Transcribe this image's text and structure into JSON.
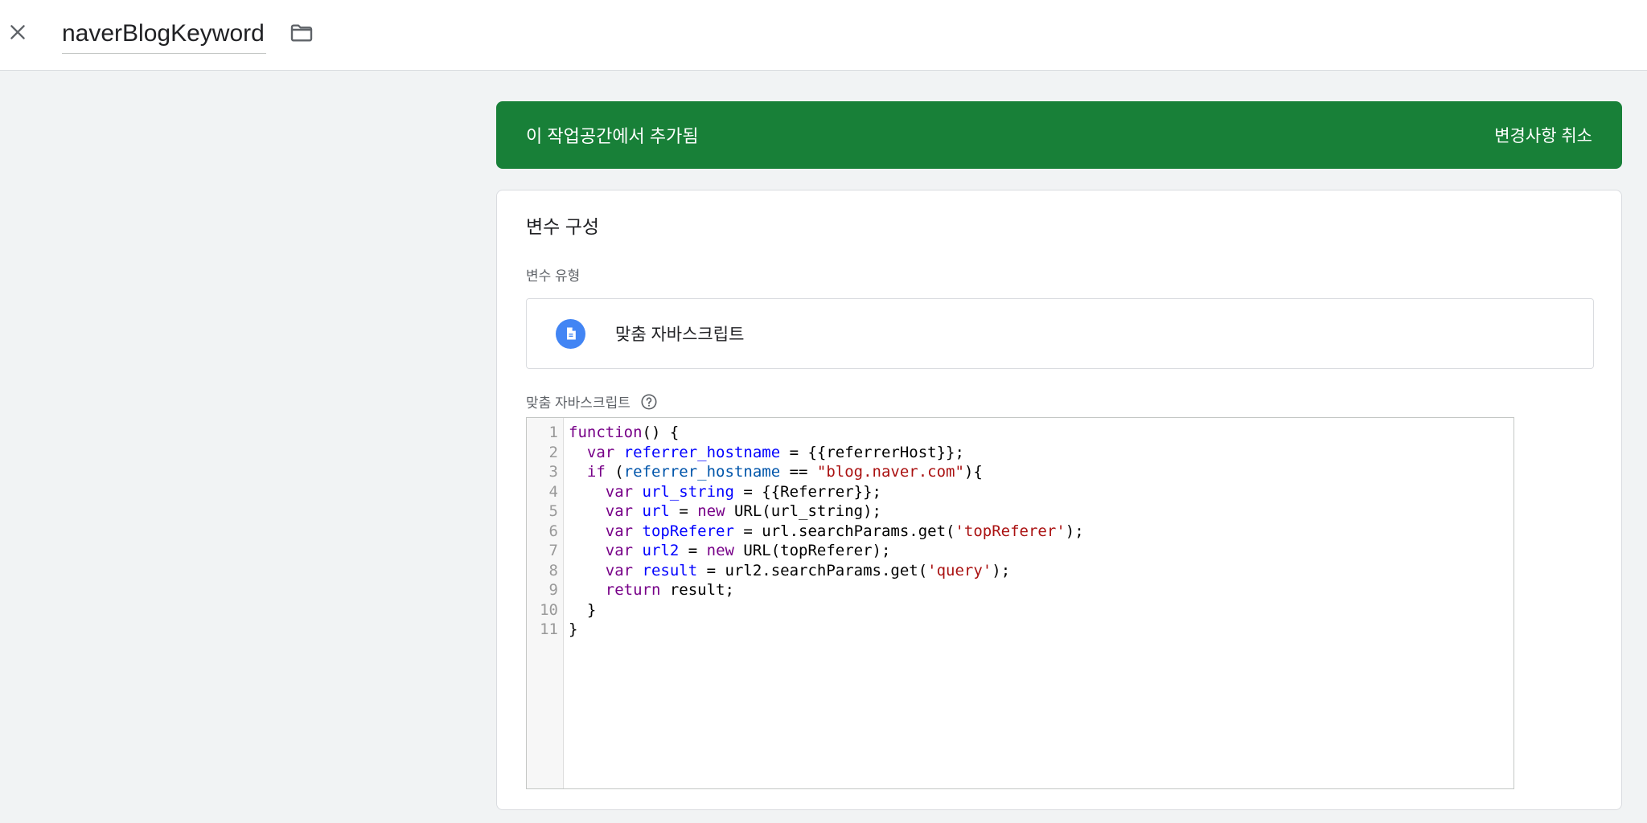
{
  "header": {
    "title": "naverBlogKeyword",
    "close_icon": "close-icon",
    "folder_icon": "folder-icon"
  },
  "banner": {
    "message": "이 작업공간에서 추가됨",
    "action_label": "변경사항 취소",
    "color": "#188038"
  },
  "config": {
    "section_title": "변수 구성",
    "type_label": "변수 유형",
    "type_name": "맞춤 자바스크립트",
    "type_icon": "document-icon",
    "code_label": "맞춤 자바스크립트",
    "help_icon": "help-icon"
  },
  "code": {
    "line_numbers": [
      "1",
      "2",
      "3",
      "4",
      "5",
      "6",
      "7",
      "8",
      "9",
      "10",
      "11"
    ],
    "lines": [
      {
        "indent": "",
        "tokens": [
          {
            "t": "function",
            "c": "kw"
          },
          {
            "t": "() {",
            "c": ""
          }
        ]
      },
      {
        "indent": "  ",
        "tokens": [
          {
            "t": "var",
            "c": "kw"
          },
          {
            "t": " ",
            "c": ""
          },
          {
            "t": "referrer_hostname",
            "c": "def"
          },
          {
            "t": " = {{referrerHost}};",
            "c": ""
          }
        ]
      },
      {
        "indent": "  ",
        "tokens": [
          {
            "t": "if",
            "c": "kw"
          },
          {
            "t": " (",
            "c": ""
          },
          {
            "t": "referrer_hostname",
            "c": "vb"
          },
          {
            "t": " == ",
            "c": ""
          },
          {
            "t": "\"blog.naver.com\"",
            "c": "str"
          },
          {
            "t": "){",
            "c": ""
          }
        ]
      },
      {
        "indent": "    ",
        "tokens": [
          {
            "t": "var",
            "c": "kw"
          },
          {
            "t": " ",
            "c": ""
          },
          {
            "t": "url_string",
            "c": "def"
          },
          {
            "t": " = {{Referrer}};",
            "c": ""
          }
        ]
      },
      {
        "indent": "    ",
        "tokens": [
          {
            "t": "var",
            "c": "kw"
          },
          {
            "t": " ",
            "c": ""
          },
          {
            "t": "url",
            "c": "def"
          },
          {
            "t": " = ",
            "c": ""
          },
          {
            "t": "new",
            "c": "kw"
          },
          {
            "t": " URL(url_string);",
            "c": ""
          }
        ]
      },
      {
        "indent": "    ",
        "tokens": [
          {
            "t": "var",
            "c": "kw"
          },
          {
            "t": " ",
            "c": ""
          },
          {
            "t": "topReferer",
            "c": "def"
          },
          {
            "t": " = url.searchParams.get(",
            "c": ""
          },
          {
            "t": "'topReferer'",
            "c": "str"
          },
          {
            "t": ");",
            "c": ""
          }
        ]
      },
      {
        "indent": "    ",
        "tokens": [
          {
            "t": "var",
            "c": "kw"
          },
          {
            "t": " ",
            "c": ""
          },
          {
            "t": "url2",
            "c": "def"
          },
          {
            "t": " = ",
            "c": ""
          },
          {
            "t": "new",
            "c": "kw"
          },
          {
            "t": " URL(topReferer);",
            "c": ""
          }
        ]
      },
      {
        "indent": "    ",
        "tokens": [
          {
            "t": "var",
            "c": "kw"
          },
          {
            "t": " ",
            "c": ""
          },
          {
            "t": "result",
            "c": "def"
          },
          {
            "t": " = url2.searchParams.get(",
            "c": ""
          },
          {
            "t": "'query'",
            "c": "str"
          },
          {
            "t": ");",
            "c": ""
          }
        ]
      },
      {
        "indent": "    ",
        "tokens": [
          {
            "t": "return",
            "c": "kw"
          },
          {
            "t": " result;",
            "c": ""
          }
        ]
      },
      {
        "indent": "  ",
        "tokens": [
          {
            "t": "}",
            "c": ""
          }
        ]
      },
      {
        "indent": "",
        "tokens": [
          {
            "t": "}",
            "c": ""
          }
        ]
      }
    ]
  }
}
